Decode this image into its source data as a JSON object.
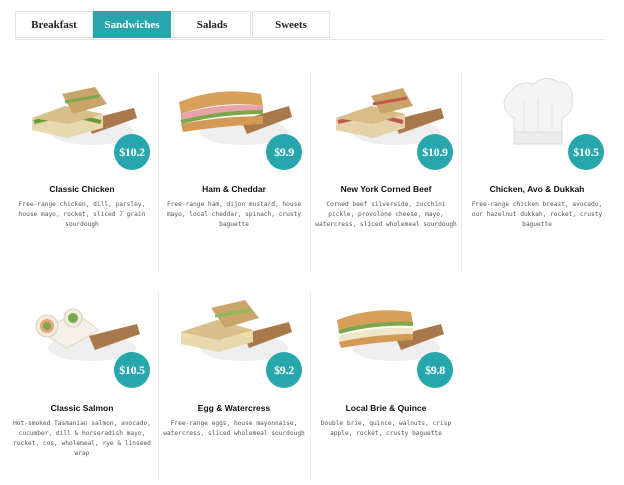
{
  "tabs": [
    "Breakfast",
    "Sandwiches",
    "Salads",
    "Sweets"
  ],
  "active_tab": "Sandwiches",
  "accent_color": "#27a6ac",
  "items": [
    {
      "name": "Classic Chicken",
      "price": "$10.2",
      "image": "sandwich-icon",
      "desc": "Free-range chicken, dill, parsley, house mayo, rocket, sliced 7 grain sourdough"
    },
    {
      "name": "Ham & Cheddar",
      "price": "$9.9",
      "image": "baguette-icon",
      "desc": "Free-range ham, dijon mustard, house mayo, local cheddar, spinach, crusty baguette"
    },
    {
      "name": "New York Corned Beef",
      "price": "$10.9",
      "image": "sandwich-icon",
      "desc": "Corned beef silverside, zucchini pickle, provolone cheese, mayo, watercress, sliced wholemeal sourdough"
    },
    {
      "name": "Chicken, Avo & Dukkah",
      "price": "$10.5",
      "image": "chef-hat-icon",
      "desc": "Free-range chicken breast, avocado, our hazelnut dukkah, rocket, crusty baguette"
    },
    {
      "name": "Classic Salmon",
      "price": "$10.5",
      "image": "wrap-icon",
      "desc": "Hot-smoked Tasmanian salmon, avocado, cucumber, dill & horseradish mayo, rocket, cos, wholemeal, rye & linseed wrap"
    },
    {
      "name": "Egg & Watercress",
      "price": "$9.2",
      "image": "sandwich-icon",
      "desc": "Free-range eggs, house mayonnaise, watercress, sliced wholemeal sourdough"
    },
    {
      "name": "Local Brie & Quince",
      "price": "$9.8",
      "image": "baguette-icon",
      "desc": "Double brie, quince, walnuts, crisp apple, rocket, crusty baguette"
    }
  ]
}
